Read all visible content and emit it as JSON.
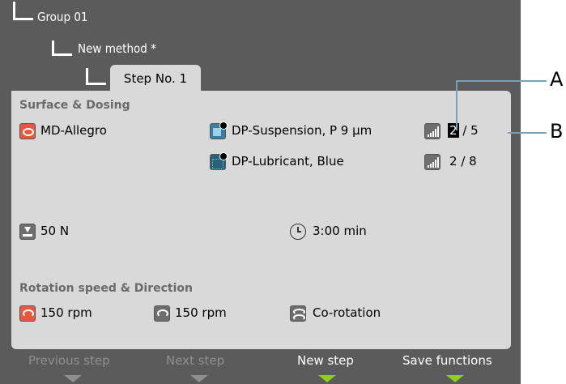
{
  "tree": {
    "group": "Group 01",
    "method": "New method *",
    "step_tab": "Step No. 1"
  },
  "surface_dosing": {
    "title": "Surface & Dosing",
    "surface": "MD-Allegro",
    "suspension": "DP-Suspension, P 9 µm",
    "suspension_level": "2",
    "suspension_max": "/ 5",
    "lubricant": "DP-Lubricant, Blue",
    "lubricant_level": "2",
    "lubricant_max": "/ 8"
  },
  "parameters": {
    "force": "50 N",
    "time": "3:00 min"
  },
  "rotation": {
    "title": "Rotation speed & Direction",
    "disc_speed": "150 rpm",
    "head_speed": "150 rpm",
    "direction": "Co-rotation"
  },
  "softkeys": {
    "previous": "Previous step",
    "next": "Next step",
    "new": "New step",
    "save": "Save functions"
  },
  "callouts": {
    "a": "A",
    "b": "B"
  },
  "icons": [
    "disc-icon",
    "suspension-bottle-icon",
    "lubricant-bottle-icon",
    "dosing-level-icon",
    "force-icon",
    "clock-icon",
    "disc-rotation-icon",
    "head-rotation-icon",
    "co-rotation-icon"
  ],
  "colors": {
    "background": "#5b5b5b",
    "panel": "#d9d9d9",
    "accent_orange": "#e9573f",
    "softkey_active_marker": "#8ccf1c",
    "callout_line": "#7a9fb8"
  }
}
